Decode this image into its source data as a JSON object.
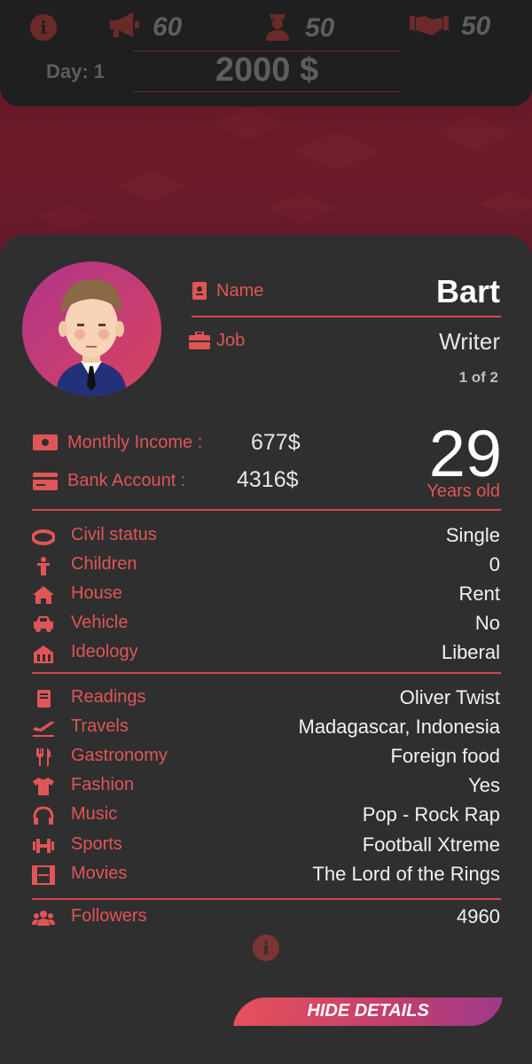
{
  "hud": {
    "popularity": "60",
    "police": "50",
    "diplomacy": "50",
    "day_label": "Day: 1",
    "money": "2000 $"
  },
  "profile": {
    "name_label": "Name",
    "name": "Bart",
    "job_label": "Job",
    "job": "Writer",
    "job_page": "1 of 2",
    "income_label": "Monthly Income :",
    "income": "677$",
    "bank_label": "Bank Account :",
    "bank": "4316$",
    "age": "29",
    "age_label": "Years old"
  },
  "status": [
    {
      "icon": "ring-icon",
      "label": "Civil status",
      "value": "Single"
    },
    {
      "icon": "child-icon",
      "label": "Children",
      "value": "0"
    },
    {
      "icon": "house-icon",
      "label": "House",
      "value": "Rent"
    },
    {
      "icon": "car-icon",
      "label": "Vehicle",
      "value": "No"
    },
    {
      "icon": "building-icon",
      "label": "Ideology",
      "value": "Liberal"
    }
  ],
  "interests": [
    {
      "icon": "book-icon",
      "label": "Readings",
      "value": "Oliver Twist"
    },
    {
      "icon": "plane-icon",
      "label": "Travels",
      "value": "Madagascar, Indonesia"
    },
    {
      "icon": "utensils-icon",
      "label": "Gastronomy",
      "value": "Foreign food"
    },
    {
      "icon": "tshirt-icon",
      "label": "Fashion",
      "value": "Yes"
    },
    {
      "icon": "headphones-icon",
      "label": "Music",
      "value": "Pop - Rock Rap"
    },
    {
      "icon": "dumbbell-icon",
      "label": "Sports",
      "value": "Football Xtreme"
    },
    {
      "icon": "film-icon",
      "label": "Movies",
      "value": "The Lord of the Rings"
    }
  ],
  "followers": {
    "icon": "users-icon",
    "label": "Followers",
    "value": "4960"
  },
  "hide_button": "HIDE DETAILS",
  "colors": {
    "accent": "#e05557",
    "background": "#2f2f2f",
    "hud": "#1f1f1f"
  }
}
